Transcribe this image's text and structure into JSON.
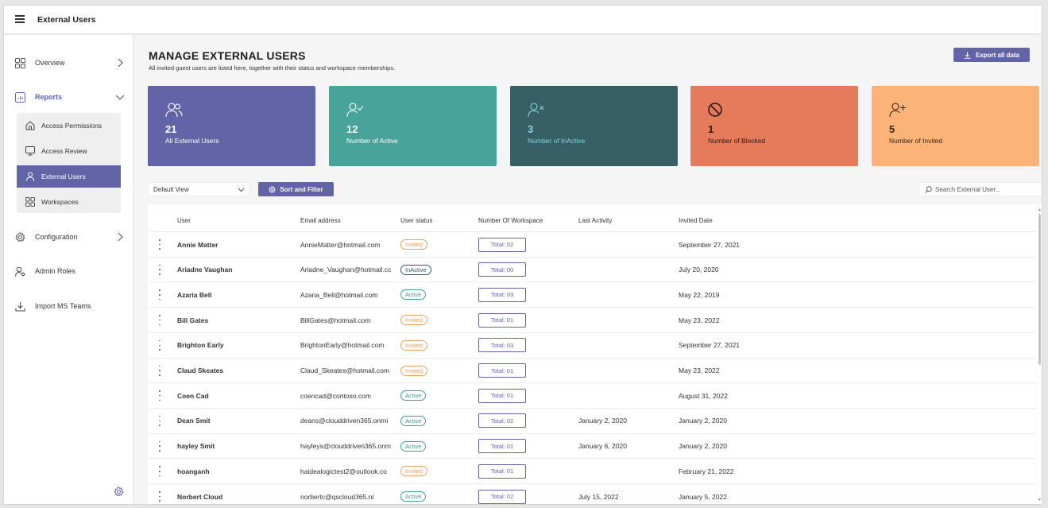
{
  "app": {
    "title": "External Users"
  },
  "sidebar": {
    "items": [
      {
        "label": "Overview",
        "icon": "grid-icon"
      },
      {
        "label": "Reports",
        "icon": "report-icon"
      },
      {
        "label": "Configuration",
        "icon": "gear-icon"
      },
      {
        "label": "Admin Roles",
        "icon": "admin-roles-icon"
      },
      {
        "label": "Import MS Teams",
        "icon": "import-icon"
      }
    ],
    "sub_items": [
      {
        "label": "Access Permissions",
        "icon": "home-icon"
      },
      {
        "label": "Access Review",
        "icon": "monitor-icon"
      },
      {
        "label": "External Users",
        "icon": "person-icon",
        "selected": true
      },
      {
        "label": "Workspaces",
        "icon": "grid-icon"
      }
    ]
  },
  "header": {
    "title": "MANAGE EXTERNAL USERS",
    "subtitle": "All invited guest users are listed here, together with their status and workspace memberships.",
    "export_label": "Export all data"
  },
  "cards": [
    {
      "value": "21",
      "label": "All External Users",
      "color": "#6264a7",
      "text_color": "#ffffff",
      "icon": "people-icon"
    },
    {
      "value": "12",
      "label": "Number of Active",
      "color": "#48a39a",
      "text_color": "#ffffff",
      "icon": "person-check-icon"
    },
    {
      "value": "3",
      "label": "Number of InActive",
      "color": "#385e66",
      "text_color": "#7fd8e0",
      "icon": "person-x-icon"
    },
    {
      "value": "1",
      "label": "Number of Blocked",
      "color": "#e57b5a",
      "text_color": "#2a1a14",
      "icon": "blocked-icon"
    },
    {
      "value": "5",
      "label": "Number of Invited",
      "color": "#fbb378",
      "text_color": "#3a2616",
      "icon": "person-add-icon"
    }
  ],
  "toolbar": {
    "view_selected": "Default View",
    "sort_label": "Sort and Filter",
    "search_placeholder": "Search External User..."
  },
  "table": {
    "columns": [
      "User",
      "Email address",
      "User status",
      "Number Of Workspace",
      "Last Activity",
      "Invited Date"
    ],
    "rows": [
      {
        "user": "Annie Matter",
        "email": "AnnieMatter@hotmail.com",
        "status": "Invited",
        "workspaces": "Total: 02",
        "last_activity": "",
        "invited": "September 27, 2021"
      },
      {
        "user": "Ariadne Vaughan",
        "email": "Ariadne_Vaughan@hotmail.cc",
        "status": "InActive",
        "workspaces": "Total: 00",
        "last_activity": "",
        "invited": "July 20, 2020"
      },
      {
        "user": "Azaria Bell",
        "email": "Azaria_Bell@hotmail.com",
        "status": "Active",
        "workspaces": "Total: 03",
        "last_activity": "",
        "invited": "May 22, 2019"
      },
      {
        "user": "Bill Gates",
        "email": "BillGates@hotmail.com",
        "status": "Invited",
        "workspaces": "Total: 01",
        "last_activity": "",
        "invited": "May 23, 2022"
      },
      {
        "user": "Brighton Early",
        "email": "BrightonEarly@hotmail.com",
        "status": "Invited",
        "workspaces": "Total: 03",
        "last_activity": "",
        "invited": "September 27, 2021"
      },
      {
        "user": "Claud Skeates",
        "email": "Claud_Skeates@hotmail.com",
        "status": "Invited",
        "workspaces": "Total: 01",
        "last_activity": "",
        "invited": "May 23, 2022"
      },
      {
        "user": "Coen Cad",
        "email": "coencad@contoso.com",
        "status": "Active",
        "workspaces": "Total: 01",
        "last_activity": "",
        "invited": "August 31, 2022"
      },
      {
        "user": "Dean Smit",
        "email": "deans@clouddriven365.onmi",
        "status": "Active",
        "workspaces": "Total: 02",
        "last_activity": "January 2, 2020",
        "invited": "January 2, 2020"
      },
      {
        "user": "hayley Smit",
        "email": "hayleys@clouddriven365.onm",
        "status": "Active",
        "workspaces": "Total: 01",
        "last_activity": "January 6, 2020",
        "invited": "January 2, 2020"
      },
      {
        "user": "hoanganh",
        "email": "haidealogictest2@outlook.co",
        "status": "Invited",
        "workspaces": "Total: 01",
        "last_activity": "",
        "invited": "February 21, 2022"
      },
      {
        "user": "Norbert Cloud",
        "email": "norbertc@qscloud365.nl",
        "status": "Active",
        "workspaces": "Total: 02",
        "last_activity": "July 15, 2022",
        "invited": "January 5, 2022"
      }
    ]
  }
}
